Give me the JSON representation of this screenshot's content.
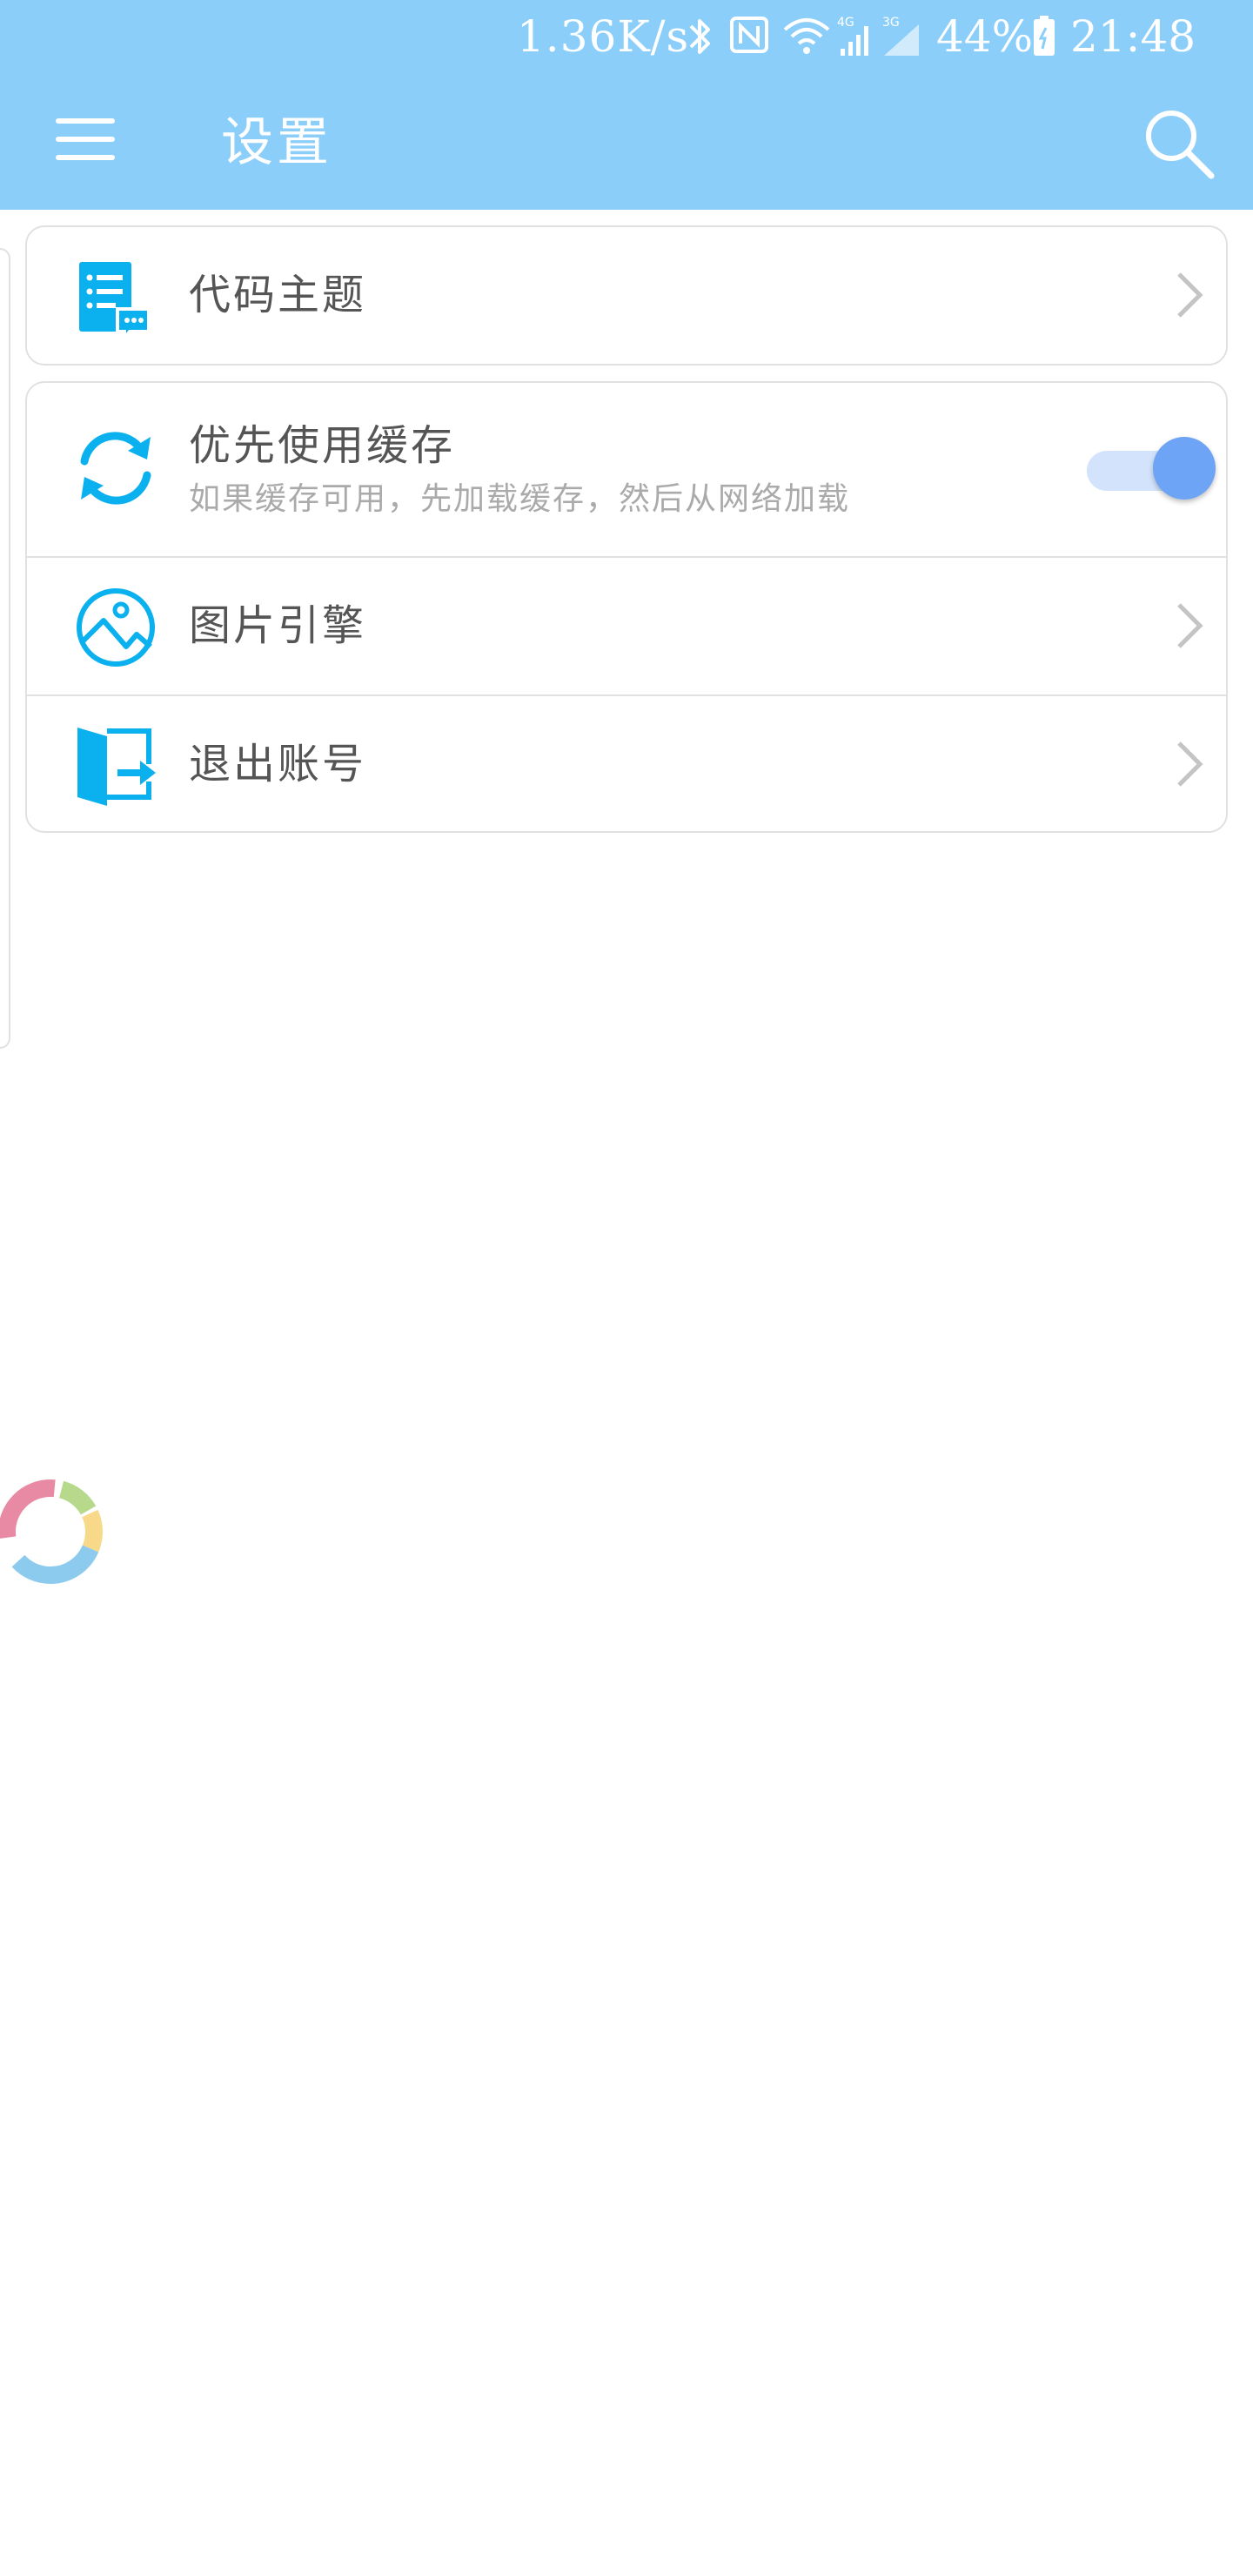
{
  "status_bar": {
    "network_speed": "1.36K/s",
    "battery_percent": "44%",
    "time": "21:48",
    "icons": [
      "bluetooth-icon",
      "nfc-icon",
      "wifi-icon",
      "signal-4g-icon",
      "signal-3g-icon",
      "battery-icon"
    ]
  },
  "header": {
    "title": "设置",
    "menu_icon": "hamburger-menu-icon",
    "search_icon": "search-icon",
    "background_color": "#8ccefa"
  },
  "settings": {
    "code_theme": {
      "label": "代码主题",
      "icon": "code-document-icon"
    },
    "prefer_cache": {
      "label": "优先使用缓存",
      "description": "如果缓存可用，先加载缓存，然后从网络加载",
      "icon": "sync-icon",
      "enabled": true
    },
    "image_engine": {
      "label": "图片引擎",
      "icon": "image-icon"
    },
    "logout": {
      "label": "退出账号",
      "icon": "logout-door-icon"
    }
  },
  "colors": {
    "accent_icon": "#0bb1ef",
    "toggle_on": "#6ea4f6",
    "label_text": "#555555",
    "secondary_text": "#aaaaaa"
  }
}
